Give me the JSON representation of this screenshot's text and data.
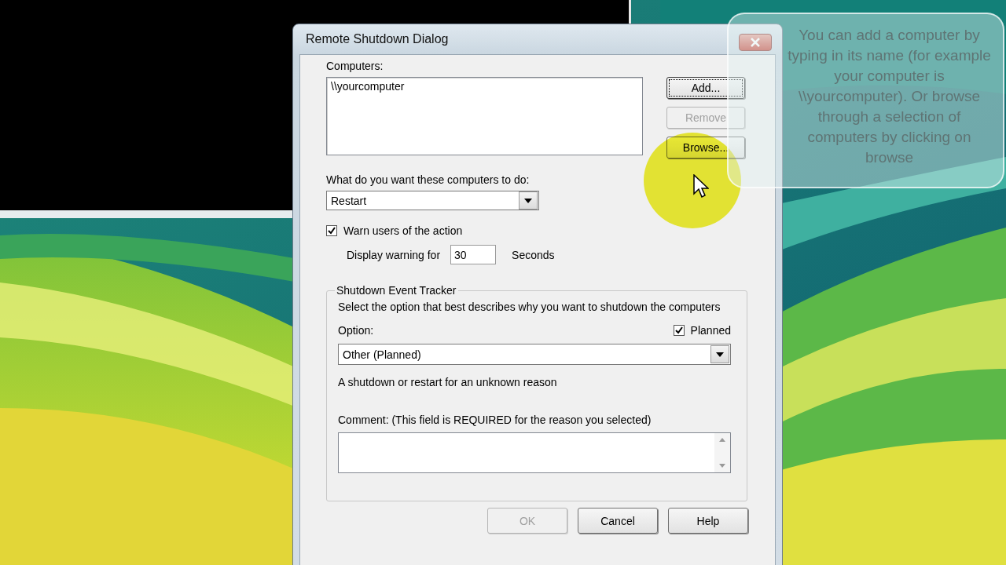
{
  "window": {
    "title": "Remote Shutdown Dialog"
  },
  "computers": {
    "label": "Computers:",
    "items": [
      "\\\\yourcomputer"
    ]
  },
  "side_buttons": [
    {
      "label": "Add...",
      "disabled": false,
      "focused": true
    },
    {
      "label": "Remove",
      "disabled": true,
      "focused": false
    },
    {
      "label": "Browse...",
      "disabled": false,
      "focused": false
    }
  ],
  "action": {
    "label": "What do you want these computers to do:",
    "value": "Restart"
  },
  "warn": {
    "label": "Warn users of the action",
    "checked": true
  },
  "warning_time": {
    "label": "Display warning for",
    "value": "30",
    "unit": "Seconds"
  },
  "tracker": {
    "title": "Shutdown Event Tracker",
    "description": "Select the option that best describes why you want to shutdown the computers",
    "option_label": "Option:",
    "planned": {
      "label": "Planned",
      "checked": true
    },
    "option_value": "Other (Planned)",
    "reason": "A shutdown or restart for an unknown reason",
    "comment_label": "Comment: (This field is REQUIRED for the reason you selected)"
  },
  "buttons": [
    {
      "label": "OK",
      "disabled": true
    },
    {
      "label": "Cancel",
      "disabled": false
    },
    {
      "label": "Help",
      "disabled": false
    }
  ],
  "tooltip": {
    "text": "You can add a computer by typing in its name (for example your computer is \\\\yourcomputer). Or browse through a selection of computers by clicking on browse"
  }
}
